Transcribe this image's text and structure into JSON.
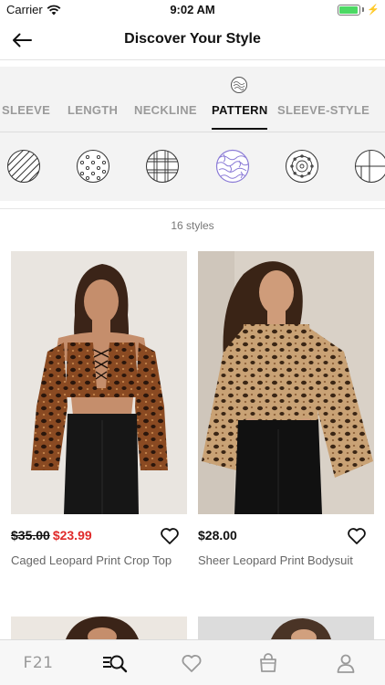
{
  "status_bar": {
    "carrier": "Carrier",
    "time": "9:02 AM",
    "battery_level": 0.95,
    "icons": [
      "wifi-icon",
      "battery-icon",
      "charging-bolt-icon"
    ]
  },
  "header": {
    "title": "Discover Your Style",
    "back_icon": "back-arrow-icon"
  },
  "filter": {
    "selected_icon": "pattern-selected-icon",
    "tabs": [
      {
        "label": "SLEEVE",
        "active": false
      },
      {
        "label": "LENGTH",
        "active": false
      },
      {
        "label": "NECKLINE",
        "active": false
      },
      {
        "label": "PATTERN",
        "active": true
      },
      {
        "label": "SLEEVE-STYLE",
        "active": false
      }
    ],
    "patterns": [
      {
        "name": "stripes-pattern-icon",
        "selected": false
      },
      {
        "name": "polka-dot-pattern-icon",
        "selected": false
      },
      {
        "name": "plaid-pattern-icon",
        "selected": false
      },
      {
        "name": "animal-print-pattern-icon",
        "selected": true
      },
      {
        "name": "medallion-pattern-icon",
        "selected": false
      },
      {
        "name": "colorblock-pattern-icon",
        "selected": false
      }
    ],
    "accent_color": "#8a7ad6"
  },
  "results": {
    "count_label": "16 styles"
  },
  "products": [
    {
      "name": "Caged Leopard Print Crop Top",
      "price_original": "$35.00",
      "price_sale": "$23.99",
      "image": "leopard-crop-top-photo"
    },
    {
      "name": "Sheer Leopard Print Bodysuit",
      "price": "$28.00",
      "image": "leopard-bodysuit-photo"
    }
  ],
  "tab_bar": {
    "items": [
      {
        "label": "F21",
        "icon": "f21-logo",
        "active": false
      },
      {
        "icon": "discover-search-icon",
        "active": true
      },
      {
        "icon": "heart-icon",
        "active": false
      },
      {
        "icon": "bag-icon",
        "active": false
      },
      {
        "icon": "profile-icon",
        "active": false
      }
    ]
  },
  "colors": {
    "sale_price": "#e02a2a",
    "active_text": "#111111",
    "inactive_text": "#9a9a9a"
  }
}
